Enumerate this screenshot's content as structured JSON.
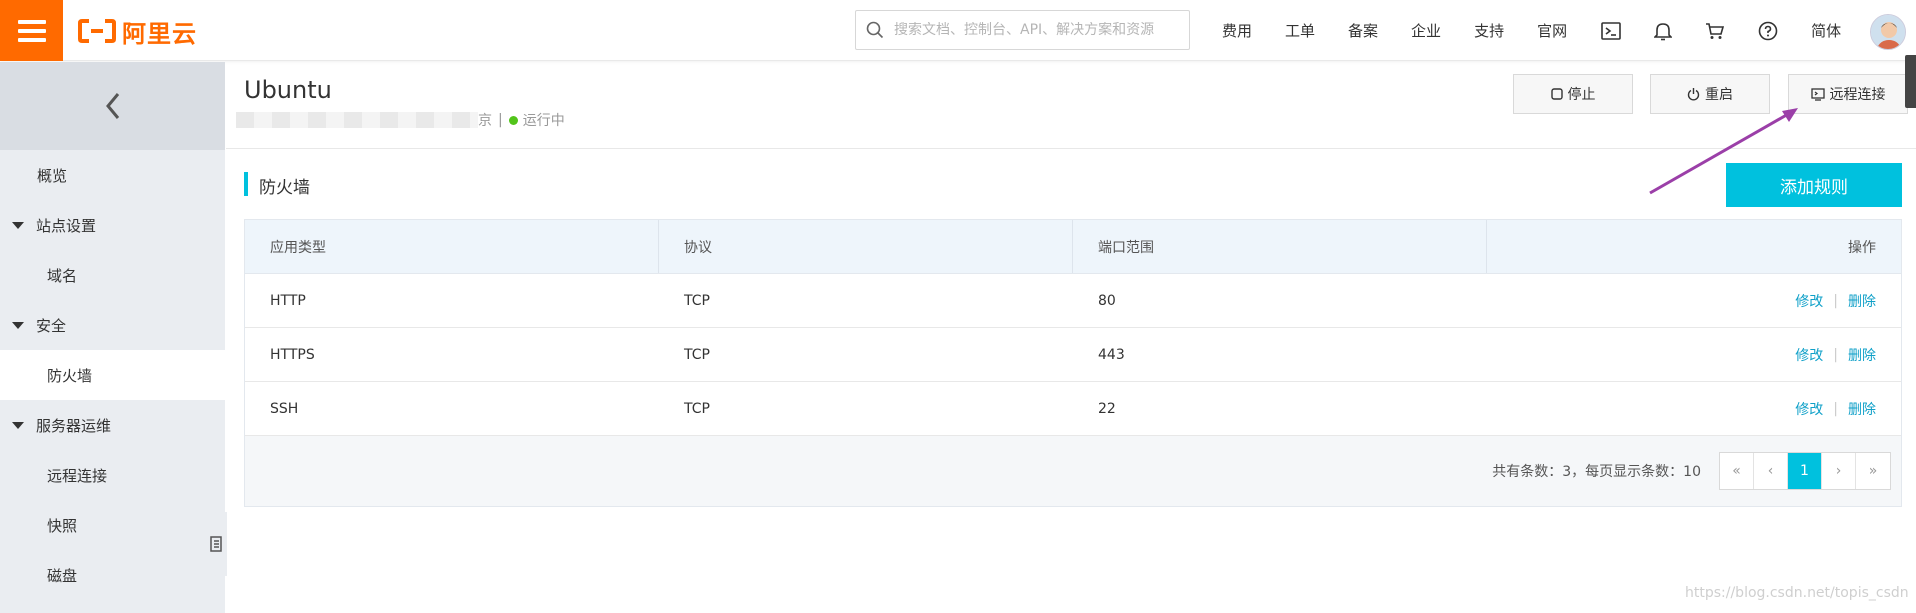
{
  "header": {
    "logo_text": "阿里云",
    "search_placeholder": "搜索文档、控制台、API、解决方案和资源",
    "nav": [
      "费用",
      "工单",
      "备案",
      "企业",
      "支持",
      "官网"
    ],
    "lang": "简体",
    "brand_color": "#ff6a00"
  },
  "sidebar": {
    "items": [
      {
        "label": "概览",
        "kind": "l1",
        "active": false
      },
      {
        "label": "站点设置",
        "kind": "group"
      },
      {
        "label": "域名",
        "kind": "l2",
        "active": false
      },
      {
        "label": "安全",
        "kind": "group"
      },
      {
        "label": "防火墙",
        "kind": "l2",
        "active": true
      },
      {
        "label": "服务器运维",
        "kind": "group"
      },
      {
        "label": "远程连接",
        "kind": "l2",
        "active": false
      },
      {
        "label": "快照",
        "kind": "l2",
        "active": false
      },
      {
        "label": "磁盘",
        "kind": "l2",
        "active": false
      }
    ]
  },
  "instance": {
    "title": "Ubuntu",
    "region_suffix": "京",
    "separator": "|",
    "status": "运行中",
    "status_color": "#52c41a"
  },
  "actions": {
    "stop": "停止",
    "restart": "重启",
    "remote": "远程连接"
  },
  "firewall": {
    "section_title": "防火墙",
    "add_button": "添加规则",
    "accent": "#00c1de",
    "columns": [
      "应用类型",
      "协议",
      "端口范围",
      "操作"
    ],
    "rows": [
      {
        "app": "HTTP",
        "protocol": "TCP",
        "port": "80",
        "edit": "修改",
        "delete": "删除"
      },
      {
        "app": "HTTPS",
        "protocol": "TCP",
        "port": "443",
        "edit": "修改",
        "delete": "删除"
      },
      {
        "app": "SSH",
        "protocol": "TCP",
        "port": "22",
        "edit": "修改",
        "delete": "删除"
      }
    ],
    "pagination": {
      "total_text": "共有条数：3，每页显示条数：10",
      "first": "«",
      "prev": "‹",
      "current": "1",
      "next": "›",
      "last": "»"
    }
  },
  "annotation": {
    "arrow_color": "#9b3fa8"
  },
  "watermark": "https://blog.csdn.net/topis_csdn"
}
